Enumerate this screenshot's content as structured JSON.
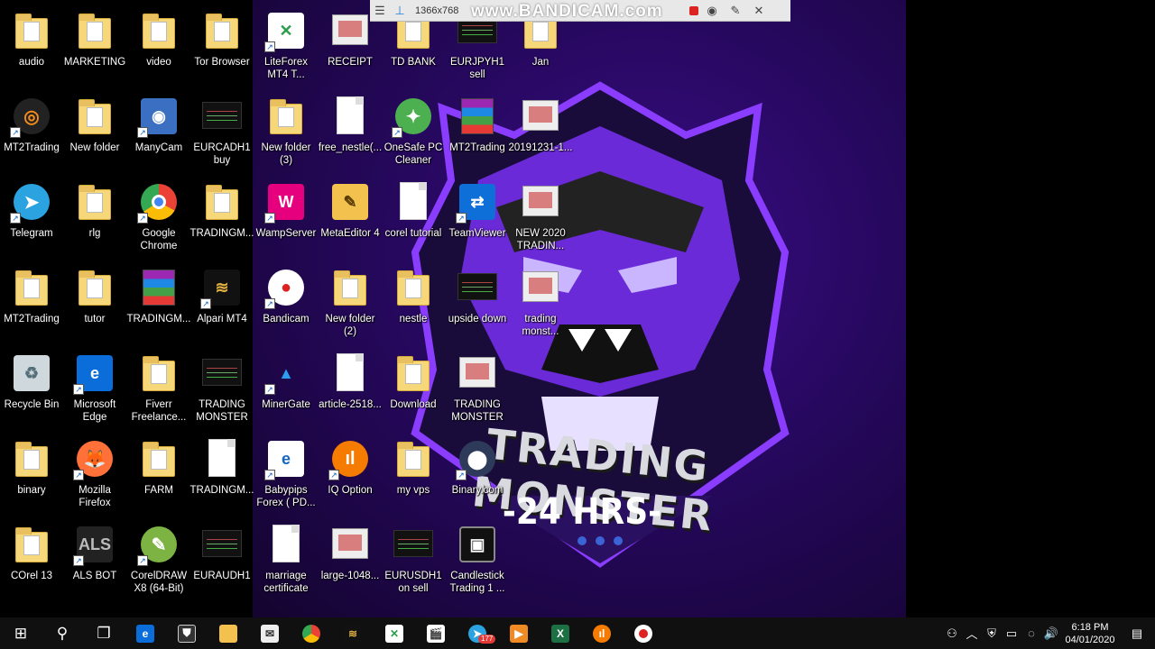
{
  "recorder": {
    "resolution": "1366x768",
    "brand": "www.BANDICAM.com"
  },
  "wallpaper": {
    "title": "TRADING MONSTER",
    "subtitle": "-24 HRS-"
  },
  "icons": [
    {
      "label": "audio",
      "type": "folder-green"
    },
    {
      "label": "MARKETING",
      "type": "folder"
    },
    {
      "label": "video",
      "type": "folder"
    },
    {
      "label": "Tor Browser",
      "type": "folder-green"
    },
    {
      "label": "LiteForex\nMT4 T...",
      "type": "liteforex"
    },
    {
      "label": "RECEIPT",
      "type": "photo"
    },
    {
      "label": "TD BANK",
      "type": "folder"
    },
    {
      "label": "EURJPYH1\nsell",
      "type": "chart"
    },
    {
      "label": "Jan",
      "type": "folder"
    },
    {
      "label": "MT2Trading",
      "type": "mt2"
    },
    {
      "label": "New folder",
      "type": "folder"
    },
    {
      "label": "ManyCam",
      "type": "manycam"
    },
    {
      "label": "EURCADH1\nbuy",
      "type": "chart"
    },
    {
      "label": "New folder\n(3)",
      "type": "folder"
    },
    {
      "label": "free_nestle(...",
      "type": "doc"
    },
    {
      "label": "OneSafe PC\nCleaner",
      "type": "onesafe"
    },
    {
      "label": "MT2Trading",
      "type": "rar"
    },
    {
      "label": "20191231-1...",
      "type": "photo"
    },
    {
      "label": "Telegram",
      "type": "telegram"
    },
    {
      "label": "rlg",
      "type": "folder"
    },
    {
      "label": "Google\nChrome",
      "type": "chrome"
    },
    {
      "label": "TRADINGM...",
      "type": "folder"
    },
    {
      "label": "WampServer",
      "type": "wamp"
    },
    {
      "label": "MetaEditor 4",
      "type": "metaeditor"
    },
    {
      "label": "corel tutorial",
      "type": "doc"
    },
    {
      "label": "TeamViewer",
      "type": "teamviewer"
    },
    {
      "label": "NEW 2020\nTRADIN...",
      "type": "photo"
    },
    {
      "label": "MT2Trading",
      "type": "folder"
    },
    {
      "label": "tutor",
      "type": "folder"
    },
    {
      "label": "TRADINGM...",
      "type": "rar"
    },
    {
      "label": "Alpari MT4",
      "type": "alpari"
    },
    {
      "label": "Bandicam",
      "type": "bandicam"
    },
    {
      "label": "New folder\n(2)",
      "type": "folder"
    },
    {
      "label": "nestle",
      "type": "folder"
    },
    {
      "label": "upside down",
      "type": "chart"
    },
    {
      "label": "trading\nmonst...",
      "type": "photo"
    },
    {
      "label": "Recycle Bin",
      "type": "recycle"
    },
    {
      "label": "Microsoft\nEdge",
      "type": "edge"
    },
    {
      "label": "Fiverr\nFreelance...",
      "type": "folder"
    },
    {
      "label": "TRADING\nMONSTER",
      "type": "chart"
    },
    {
      "label": "MinerGate",
      "type": "minergate"
    },
    {
      "label": "article-2518...",
      "type": "doc"
    },
    {
      "label": "Download",
      "type": "folder"
    },
    {
      "label": "TRADING\nMONSTER",
      "type": "photo"
    },
    {
      "label": "binary",
      "type": "folder"
    },
    {
      "label": "Mozilla\nFirefox",
      "type": "firefox"
    },
    {
      "label": "FARM",
      "type": "folder"
    },
    {
      "label": "TRADINGM...",
      "type": "doc"
    },
    {
      "label": "Babypips\nForex ( PD...",
      "type": "pdf"
    },
    {
      "label": "IQ Option",
      "type": "iqoption"
    },
    {
      "label": "my vps",
      "type": "folder"
    },
    {
      "label": "Binary.com",
      "type": "binarycom"
    },
    {
      "label": "COrel 13",
      "type": "folder"
    },
    {
      "label": "ALS BOT",
      "type": "alsbot"
    },
    {
      "label": "CorelDRAW\nX8 (64-Bit)",
      "type": "corel"
    },
    {
      "label": "EURAUDH1",
      "type": "chart"
    },
    {
      "label": "marriage\ncertificate",
      "type": "doc"
    },
    {
      "label": "large-1048...",
      "type": "photo"
    },
    {
      "label": "EURUSDH1\non sell",
      "type": "chart"
    },
    {
      "label": "Candlestick\nTrading 1 ...",
      "type": "video"
    }
  ],
  "taskbar": {
    "telegram_badge": "177",
    "time": "6:18 PM",
    "date": "04/01/2020"
  },
  "colors": {
    "wallpaper": "#26085e",
    "taskbar": "#101010",
    "accent_purple": "#8a3cff"
  }
}
